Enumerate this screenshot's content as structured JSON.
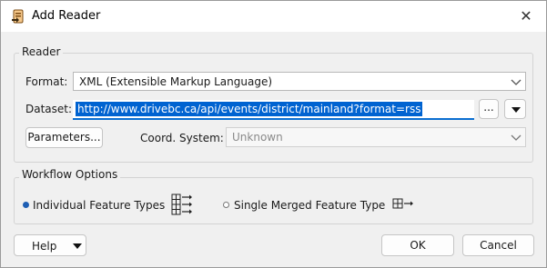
{
  "window": {
    "title": "Add Reader",
    "close_glyph": "✕"
  },
  "reader_group": {
    "label": "Reader",
    "format": {
      "label": "Format:",
      "value": "XML (Extensible Markup Language)"
    },
    "dataset": {
      "label": "Dataset:",
      "value": "http://www.drivebc.ca/api/events/district/mainland?format=rss",
      "browse_label": "..."
    },
    "parameters_button": "Parameters...",
    "coord_system": {
      "label": "Coord. System:",
      "value": "Unknown"
    }
  },
  "workflow_group": {
    "label": "Workflow Options",
    "options": [
      {
        "label": "Individual Feature Types",
        "selected": true,
        "icon": "individual-feature-types-icon"
      },
      {
        "label": "Single Merged Feature Type",
        "selected": false,
        "icon": "single-merged-feature-type-icon"
      }
    ]
  },
  "footer": {
    "help_label": "Help",
    "ok_label": "OK",
    "cancel_label": "Cancel"
  },
  "colors": {
    "selection": "#0063d1",
    "accent": "#0a6ed1",
    "radio_selected": "#1f5fb4"
  }
}
